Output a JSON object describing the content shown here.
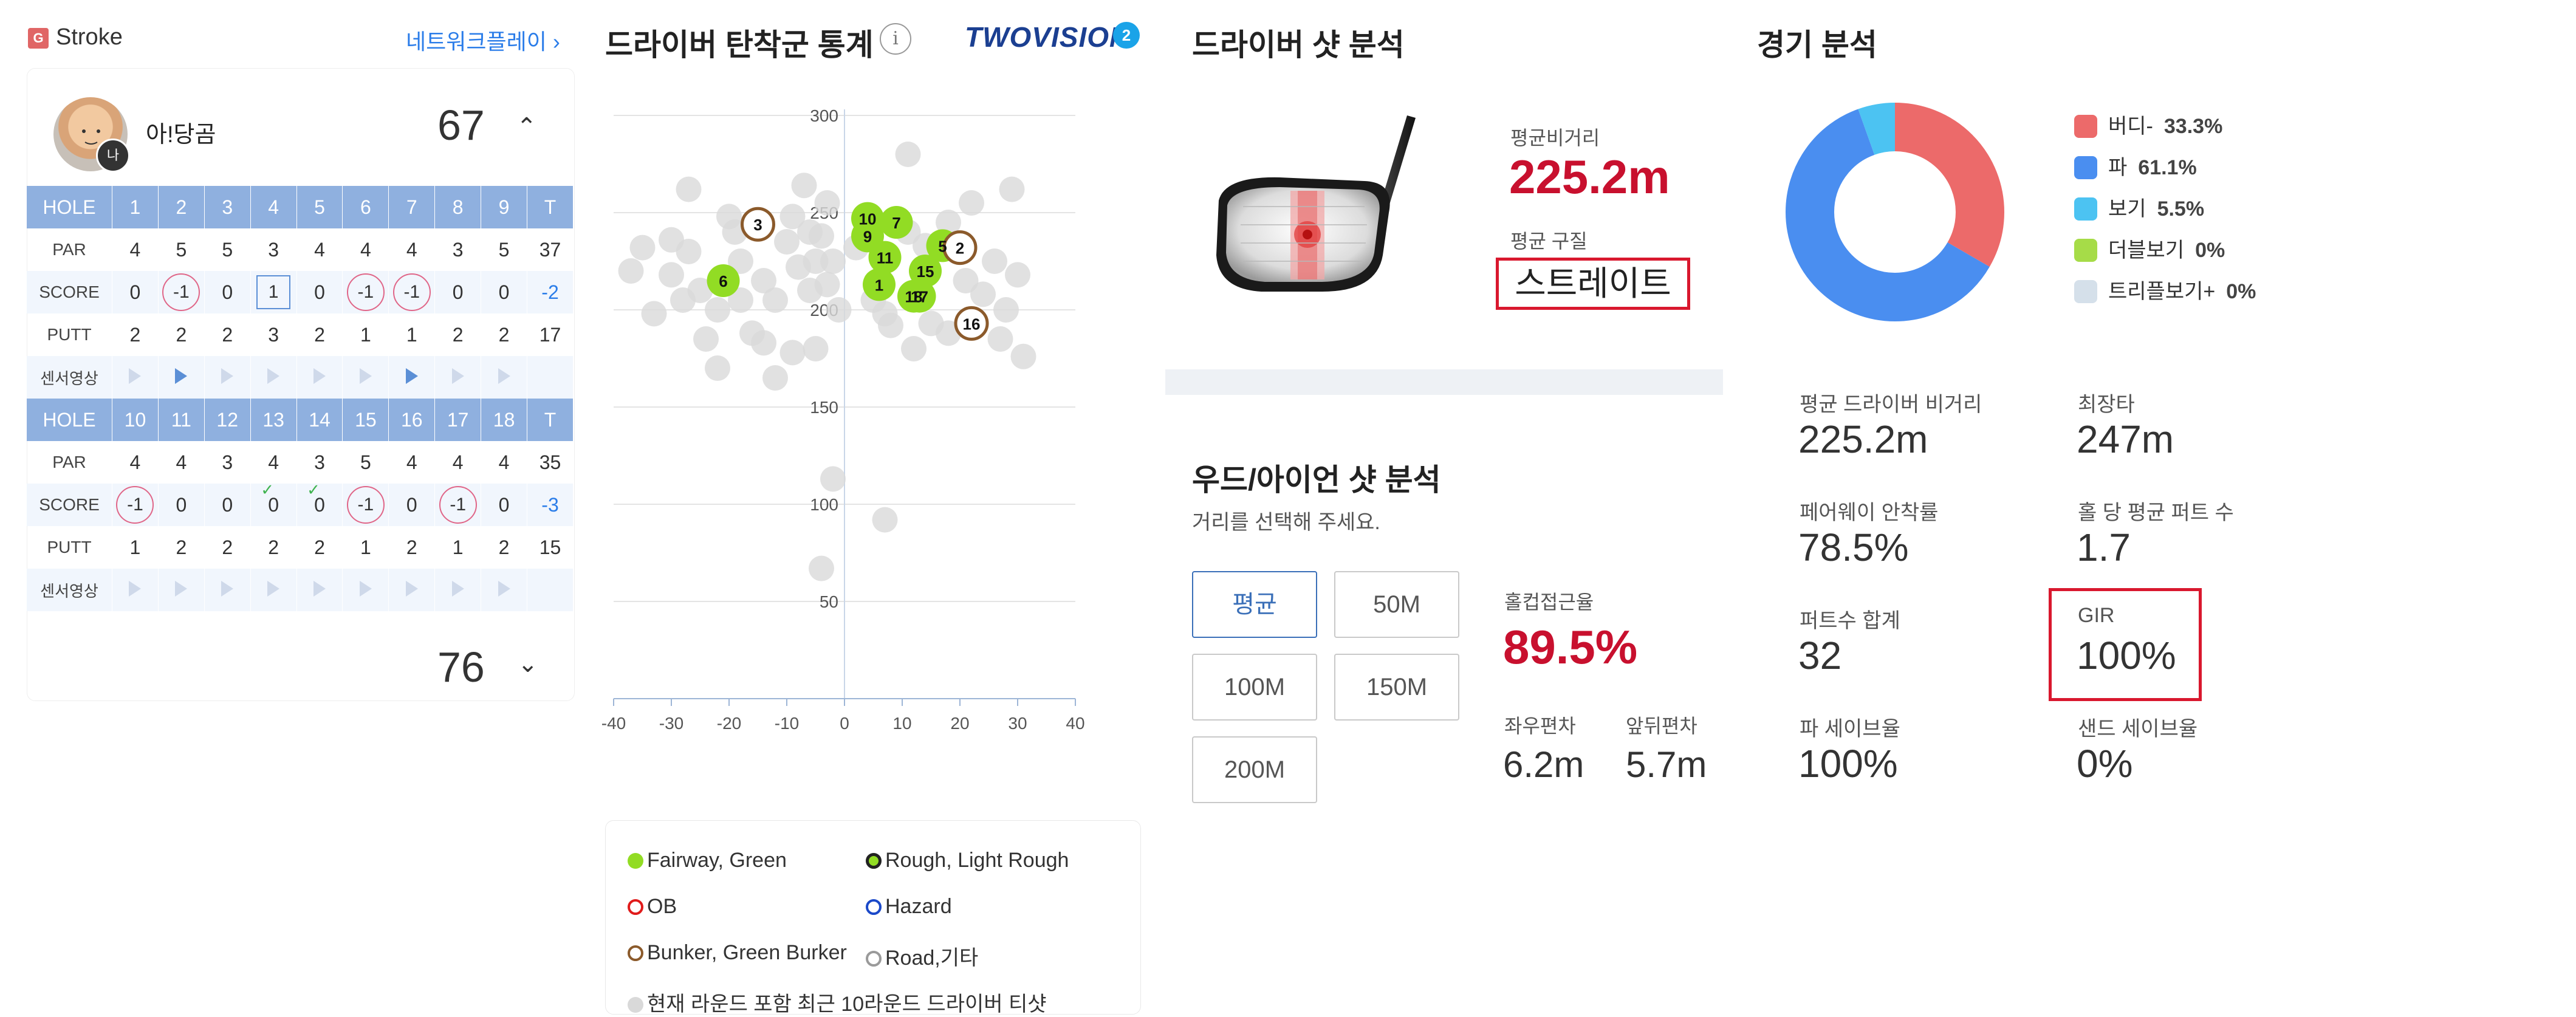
{
  "scorecard": {
    "mode_badge": "G",
    "mode_label": "Stroke",
    "network_link": "네트워크플레이 ›",
    "me_badge": "나",
    "player_name": "아!당곰",
    "front_total": "67",
    "back_total": "76",
    "front": {
      "hole": [
        "HOLE",
        "1",
        "2",
        "3",
        "4",
        "5",
        "6",
        "7",
        "8",
        "9",
        "T"
      ],
      "par": [
        "PAR",
        "4",
        "5",
        "5",
        "3",
        "4",
        "4",
        "4",
        "3",
        "5",
        "37"
      ],
      "score": [
        "SCORE",
        "0",
        "-1",
        "0",
        "1",
        "0",
        "-1",
        "-1",
        "0",
        "0",
        "-2"
      ],
      "putt": [
        "PUTT",
        "2",
        "2",
        "2",
        "3",
        "2",
        "1",
        "1",
        "2",
        "2",
        "17"
      ],
      "video_label": "센서영상"
    },
    "back": {
      "hole": [
        "HOLE",
        "10",
        "11",
        "12",
        "13",
        "14",
        "15",
        "16",
        "17",
        "18",
        "T"
      ],
      "par": [
        "PAR",
        "4",
        "4",
        "3",
        "4",
        "3",
        "5",
        "4",
        "4",
        "4",
        "35"
      ],
      "score": [
        "SCORE",
        "-1",
        "0",
        "0",
        "0",
        "0",
        "-1",
        "0",
        "-1",
        "0",
        "-3"
      ],
      "putt": [
        "PUTT",
        "1",
        "2",
        "2",
        "2",
        "2",
        "1",
        "2",
        "1",
        "2",
        "15"
      ],
      "video_label": "센서영상"
    }
  },
  "driver_stats": {
    "title": "드라이버 탄착군 통계",
    "info_icon": "i",
    "brand": "TWOVISION",
    "brand_mark": "2",
    "legend": {
      "fairway": "Fairway, Green",
      "rough": "Rough, Light Rough",
      "ob": "OB",
      "hazard": "Hazard",
      "bunker": "Bunker, Green Burker",
      "road": "Road,기타",
      "history": "현재 라운드 포함 최근 10라운드 드라이버 티샷"
    }
  },
  "driver_analysis": {
    "title": "드라이버 샷 분석",
    "avg_distance_label": "평균비거리",
    "avg_distance": "225.2m",
    "avg_shape_label": "평균 구질",
    "avg_shape": "스트레이트"
  },
  "wood_iron": {
    "title": "우드/아이언 샷 분석",
    "subtitle": "거리를 선택해 주세요.",
    "buttons": [
      "평균",
      "50M",
      "100M",
      "150M",
      "200M"
    ],
    "selected": "평균",
    "cup_label": "홀컵접근율",
    "cup_value": "89.5%",
    "lr_label": "좌우편차",
    "lr_value": "6.2m",
    "fb_label": "앞뒤편차",
    "fb_value": "5.7m"
  },
  "game_analysis": {
    "title": "경기 분석",
    "legend": [
      {
        "label": "버디-",
        "pct": "33.3%",
        "color": "#ec6a6a"
      },
      {
        "label": "파",
        "pct": "61.1%",
        "color": "#4a8ef0"
      },
      {
        "label": "보기",
        "pct": "5.5%",
        "color": "#4cc3f2"
      },
      {
        "label": "더블보기",
        "pct": "0%",
        "color": "#a6dc48"
      },
      {
        "label": "트리플보기+",
        "pct": "0%",
        "color": "#d5e0ea"
      }
    ],
    "stats": {
      "avg_drive_label": "평균 드라이버 비거리",
      "avg_drive": "225.2m",
      "longest_label": "최장타",
      "longest": "247m",
      "fairway_label": "페어웨이 안착률",
      "fairway": "78.5%",
      "putt_avg_label": "홀 당 평균 퍼트 수",
      "putt_avg": "1.7",
      "putt_total_label": "퍼트수 합계",
      "putt_total": "32",
      "gir_label": "GIR",
      "gir": "100%",
      "par_save_label": "파 세이브율",
      "par_save": "100%",
      "sand_save_label": "샌드 세이브율",
      "sand_save": "0%"
    }
  },
  "chart_data": [
    {
      "type": "scatter",
      "title": "드라이버 탄착군 통계",
      "xlim": [
        -40,
        40
      ],
      "ylim": [
        0,
        300
      ],
      "x_ticks": [
        -40,
        -30,
        -20,
        -10,
        0,
        10,
        20,
        30,
        40
      ],
      "y_ticks": [
        50,
        100,
        150,
        200,
        250,
        300
      ],
      "grid": true,
      "series": [
        {
          "name": "Fairway, Green",
          "color": "#92dc24",
          "points": [
            {
              "label": "10",
              "x": 4,
              "y": 247
            },
            {
              "label": "9",
              "x": 4,
              "y": 238
            },
            {
              "label": "7",
              "x": 9,
              "y": 245
            },
            {
              "label": "11",
              "x": 7,
              "y": 227
            },
            {
              "label": "6",
              "x": -21,
              "y": 215
            },
            {
              "label": "1",
              "x": 6,
              "y": 213
            },
            {
              "label": "18",
              "x": 12,
              "y": 207
            },
            {
              "label": "17",
              "x": 13,
              "y": 207
            },
            {
              "label": "15",
              "x": 14,
              "y": 220
            },
            {
              "label": "5",
              "x": 17,
              "y": 233
            }
          ]
        },
        {
          "name": "Bunker, Green Burker",
          "color": "#8b5a2b",
          "points": [
            {
              "label": "3",
              "x": -15,
              "y": 244
            },
            {
              "label": "2",
              "x": 20,
              "y": 232
            },
            {
              "label": "16",
              "x": 22,
              "y": 193
            }
          ]
        },
        {
          "name": "현재 라운드 포함 최근 10라운드 드라이버 티샷",
          "color": "#d9d9d9",
          "points": [
            {
              "x": -27,
              "y": 230
            },
            {
              "x": -35,
              "y": 232
            },
            {
              "x": -30,
              "y": 218
            },
            {
              "x": -25,
              "y": 210
            },
            {
              "x": -22,
              "y": 200
            },
            {
              "x": -28,
              "y": 205
            },
            {
              "x": -18,
              "y": 225
            },
            {
              "x": -14,
              "y": 215
            },
            {
              "x": -10,
              "y": 235
            },
            {
              "x": -8,
              "y": 222
            },
            {
              "x": -12,
              "y": 205
            },
            {
              "x": -6,
              "y": 210
            },
            {
              "x": -4,
              "y": 238
            },
            {
              "x": -2,
              "y": 225
            },
            {
              "x": -1,
              "y": 200
            },
            {
              "x": -9,
              "y": 248
            },
            {
              "x": -3,
              "y": 255
            },
            {
              "x": -27,
              "y": 262
            },
            {
              "x": -20,
              "y": 248
            },
            {
              "x": -37,
              "y": 220
            },
            {
              "x": -33,
              "y": 198
            },
            {
              "x": -16,
              "y": 188
            },
            {
              "x": -5,
              "y": 180
            },
            {
              "x": -22,
              "y": 170
            },
            {
              "x": -12,
              "y": 165
            },
            {
              "x": -9,
              "y": 178
            },
            {
              "x": 2,
              "y": 232
            },
            {
              "x": 5,
              "y": 205
            },
            {
              "x": 7,
              "y": 198
            },
            {
              "x": 11,
              "y": 240
            },
            {
              "x": 14,
              "y": 233
            },
            {
              "x": 18,
              "y": 245
            },
            {
              "x": 21,
              "y": 215
            },
            {
              "x": 24,
              "y": 208
            },
            {
              "x": 26,
              "y": 225
            },
            {
              "x": 28,
              "y": 200
            },
            {
              "x": 30,
              "y": 218
            },
            {
              "x": 27,
              "y": 185
            },
            {
              "x": 31,
              "y": 176
            },
            {
              "x": 29,
              "y": 262
            },
            {
              "x": 22,
              "y": 255
            },
            {
              "x": 11,
              "y": 280
            },
            {
              "x": 18,
              "y": 188
            },
            {
              "x": 15,
              "y": 193
            },
            {
              "x": 8,
              "y": 192
            },
            {
              "x": 12,
              "y": 180
            },
            {
              "x": -19,
              "y": 240
            },
            {
              "x": -24,
              "y": 185
            },
            {
              "x": -30,
              "y": 236
            },
            {
              "x": -7,
              "y": 264
            },
            {
              "x": -14,
              "y": 183
            },
            {
              "x": -3,
              "y": 213
            },
            {
              "x": -5,
              "y": 225
            },
            {
              "x": -6,
              "y": 240
            },
            {
              "x": -18,
              "y": 205
            },
            {
              "x": -2,
              "y": 113
            },
            {
              "x": 7,
              "y": 92
            },
            {
              "x": -4,
              "y": 67
            }
          ]
        }
      ]
    },
    {
      "type": "pie",
      "title": "경기 분석",
      "labels": [
        "버디-",
        "파",
        "보기",
        "더블보기",
        "트리플보기+"
      ],
      "values": [
        33.3,
        61.1,
        5.5,
        0,
        0
      ],
      "colors": [
        "#ec6a6a",
        "#4a8ef0",
        "#4cc3f2",
        "#a6dc48",
        "#d5e0ea"
      ],
      "donut": true
    }
  ]
}
